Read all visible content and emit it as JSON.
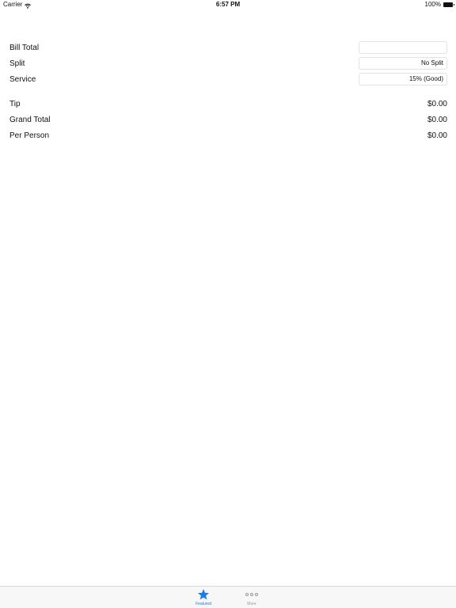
{
  "status_bar": {
    "carrier": "Carrier",
    "time": "6:57 PM",
    "battery": "100%"
  },
  "form": {
    "bill_total": {
      "label": "Bill Total",
      "value": "",
      "placeholder": ""
    },
    "split": {
      "label": "Split",
      "value": "No Split"
    },
    "service": {
      "label": "Service",
      "value": "15% (Good)"
    }
  },
  "results": {
    "tip": {
      "label": "Tip",
      "value": "$0.00"
    },
    "grand_total": {
      "label": "Grand Total",
      "value": "$0.00"
    },
    "per_person": {
      "label": "Per Person",
      "value": "$0.00"
    }
  },
  "tab_bar": {
    "tabs": [
      {
        "label": "Featured",
        "icon": "star-icon",
        "selected": true
      },
      {
        "label": "More",
        "icon": "more-icon",
        "selected": false
      }
    ]
  },
  "colors": {
    "accent": "#1a7cf4",
    "inactive": "#9a9a9a",
    "tab_bar_bg": "#f7f7f7"
  }
}
